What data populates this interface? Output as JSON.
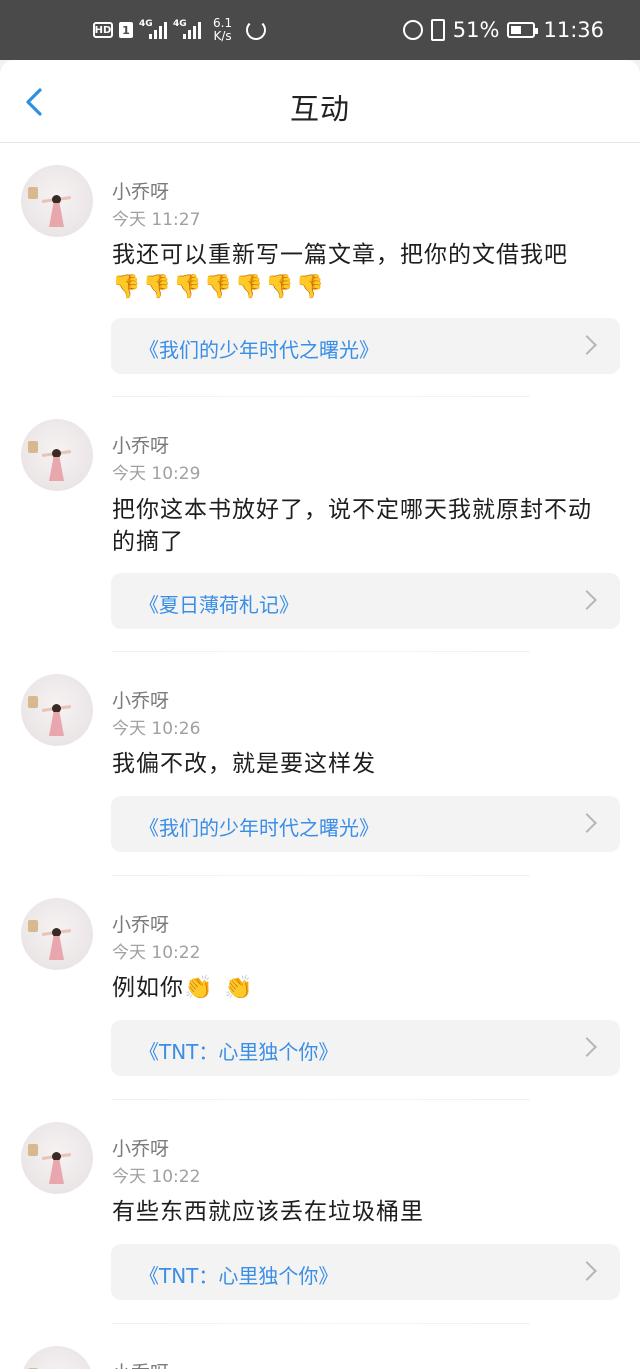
{
  "status_bar": {
    "hd": "HD",
    "sim": "1",
    "net1": "4G",
    "net2": "4G",
    "speed_value": "6.1",
    "speed_unit": "K/s",
    "battery": "51%",
    "battery_level": 0.51,
    "time": "11:36"
  },
  "header": {
    "title": "互动"
  },
  "items": [
    {
      "name": "小乔呀",
      "time": "今天 11:27",
      "text": "我还可以重新写一篇文章，把你的文借我吧",
      "emoji": "👎👎👎👎👎👎👎",
      "book": "《我们的少年时代之曙光》"
    },
    {
      "name": "小乔呀",
      "time": "今天 10:29",
      "text": "把你这本书放好了，说不定哪天我就原封不动的摘了",
      "emoji": "",
      "book": "《夏日薄荷札记》"
    },
    {
      "name": "小乔呀",
      "time": "今天 10:26",
      "text": "我偏不改，就是要这样发",
      "emoji": "",
      "book": "《我们的少年时代之曙光》"
    },
    {
      "name": "小乔呀",
      "time": "今天 10:22",
      "text": "例如你",
      "emoji": "👏 👏",
      "book": "《TNT：心里独个你》"
    },
    {
      "name": "小乔呀",
      "time": "今天 10:22",
      "text": "有些东西就应该丢在垃圾桶里",
      "emoji": "",
      "book": "《TNT：心里独个你》"
    },
    {
      "name": "小乔呀",
      "time": "",
      "text": "",
      "emoji": "",
      "book": ""
    }
  ]
}
